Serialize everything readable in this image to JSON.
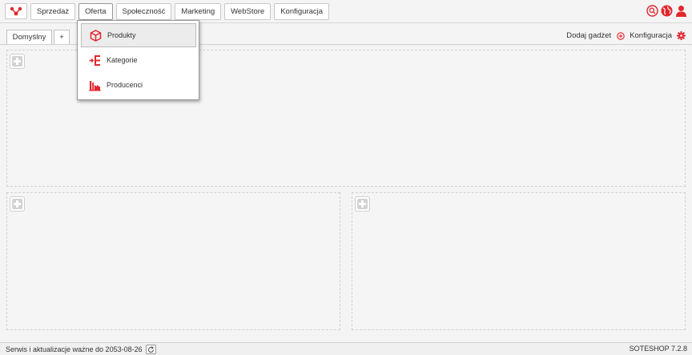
{
  "nav": {
    "items": [
      "Sprzedaż",
      "Oferta",
      "Społeczność",
      "Marketing",
      "WebStore",
      "Konfiguracja"
    ],
    "active": "Oferta"
  },
  "header_icons": [
    "search-icon",
    "globe-icon",
    "user-icon"
  ],
  "tabs": {
    "default_label": "Domyślny",
    "add_label": "+"
  },
  "tools": {
    "add_gadget": "Dodaj gadżet",
    "config": "Konfiguracja"
  },
  "dropdown": {
    "items": [
      {
        "label": "Produkty",
        "icon": "box-icon",
        "selected": true
      },
      {
        "label": "Kategorie",
        "icon": "categories-icon",
        "selected": false
      },
      {
        "label": "Producenci",
        "icon": "factory-icon",
        "selected": false
      }
    ]
  },
  "footer": {
    "service_text": "Serwis i aktualizacje ważne do 2053-08-26",
    "version": "SOTESHOP 7.2.8"
  },
  "colors": {
    "accent": "#e2262c"
  }
}
